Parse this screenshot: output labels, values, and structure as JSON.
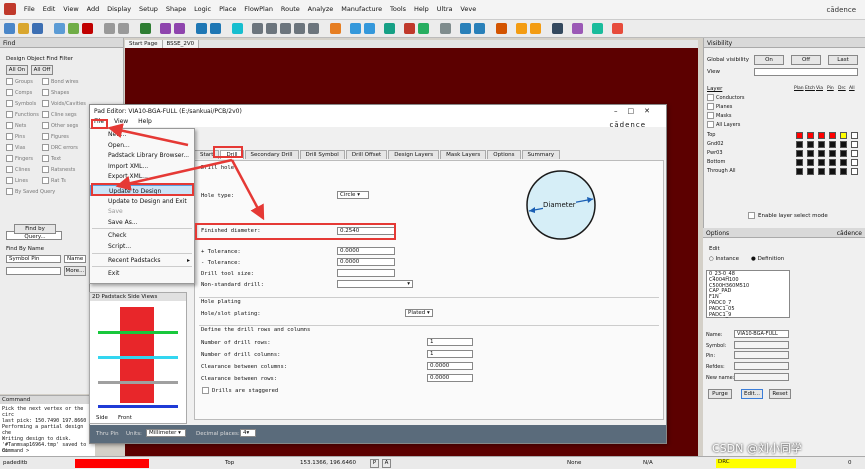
{
  "menubar": {
    "items": [
      "File",
      "Edit",
      "View",
      "Add",
      "Display",
      "Setup",
      "Shape",
      "Logic",
      "Place",
      "FlowPlan",
      "Route",
      "Analyze",
      "Manufacture",
      "Tools",
      "Help",
      "Ultra",
      "Veve"
    ],
    "brand": "cādence"
  },
  "tabs": [
    "Start Page",
    "BSSE_2V0"
  ],
  "find": {
    "title": "Find",
    "filter_title": "Design Object Find Filter",
    "all_on": "All On",
    "all_off": "All Off",
    "left": [
      "Groups",
      "Comps",
      "Symbols",
      "Functions",
      "Nets",
      "Pins",
      "Vias",
      "Fingers",
      "Clines",
      "Lines",
      "By Saved Query"
    ],
    "right": [
      "Bond wires",
      "Shapes",
      "Voids/Cavities",
      "Cline segs",
      "Other segs",
      "Figures",
      "DRC errors",
      "Text",
      "Ratsnests",
      "Rat Ts"
    ],
    "find_by_query": "Find by Query...",
    "find_by_name": "Find By Name",
    "name_type": "Symbol Pin",
    "name_mode": "Name",
    "more": "More..."
  },
  "dialog": {
    "title": "Pad Editor: VIA10-BGA-FULL  (E:/sankuai/PCB/2v0)",
    "menu": [
      "File",
      "View",
      "Help"
    ],
    "brand": "cādence",
    "tabs": [
      "Start",
      "Drill",
      "Secondary Drill",
      "Drill Symbol",
      "Drill Offset",
      "Design Layers",
      "Mask Layers",
      "Options",
      "Summary"
    ],
    "drill_hole": "Drill hole",
    "hole_type_label": "Hole type:",
    "hole_type": "Circle",
    "diameter_label": "Diameter",
    "finished_diameter_label": "Finished diameter:",
    "finished_diameter": "0.2540",
    "plus_tol_label": "+ Tolerance:",
    "plus_tol": "0.0000",
    "minus_tol_label": "- Tolerance:",
    "minus_tol": "0.0000",
    "drill_tool_label": "Drill tool size:",
    "non_std_label": "Non-standard drill:",
    "hole_plating": "Hole plating",
    "plating_label": "Hole/slot plating:",
    "plating": "Plated",
    "rows_cols_title": "Define the drill rows and columns",
    "rows_label": "Number of drill rows:",
    "rows": "1",
    "cols_label": "Number of drill columns:",
    "cols": "1",
    "clear_cols_label": "Clearance between columns:",
    "clear_cols": "0.0000",
    "clear_rows_label": "Clearance between rows:",
    "clear_rows": "0.0000",
    "staggered": "Drills are staggered",
    "thru_pin": "Thru Pin",
    "units_label": "Units:",
    "units": "Millimeter",
    "decimal_label": "Decimal places:",
    "decimal": "4"
  },
  "file_menu": [
    "New...",
    "Open...",
    "Padstack Library Browser...",
    "Import XML...",
    "Export XML...",
    "Update to Design",
    "Update to Design and Exit",
    "Save",
    "Save As...",
    "Check",
    "Script...",
    "Recent Padstacks",
    "Exit"
  ],
  "side_view": {
    "title": "2D Padstack Side Views",
    "tabs": [
      "Side",
      "Front"
    ]
  },
  "visibility": {
    "title": "Visibility",
    "global_label": "Global visibility",
    "on": "On",
    "off": "Off",
    "last": "Last",
    "view_label": "View",
    "layer_label": "Layer",
    "cols": [
      "Plan",
      "Etch",
      "Via",
      "Pin",
      "Drc",
      "All"
    ],
    "groups": [
      "Conductors",
      "Planes",
      "Masks",
      "All Layers"
    ],
    "layers": [
      "Top",
      "Gnd02",
      "Pwr03",
      "Bottom",
      "Through All"
    ],
    "enable_layer_select": "Enable layer select mode",
    "top_colors": [
      "#ff0000",
      "#ff0000",
      "#ff0000",
      "#ff0000",
      "#ffff00"
    ]
  },
  "options": {
    "title": "Options",
    "brand": "cādence",
    "edit": "Edit",
    "instance": "Instance",
    "definition": "Definition",
    "list": [
      "0_23-0_48",
      "C4004H100",
      "C500H360M510",
      "CAP_PAD",
      "F1N",
      "PADC0_7",
      "PADC1_05",
      "PADC1_9"
    ],
    "name_label": "Name:",
    "name": "VIA10-BGA-FULL",
    "symbol_label": "Symbol:",
    "pin_label": "Pin:",
    "refdes_label": "Refdes:",
    "newname_label": "New name:",
    "purge": "Purge",
    "edit_btn": "Edit...",
    "reset": "Reset"
  },
  "command": {
    "title": "Command",
    "lines": [
      "Pick the next vertex or the circ",
      "last pick:  150.7490 197.8660",
      "Performing a partial design che",
      "Writing design to disk.",
      "'#Tanmsap16964.tmp' saved to di"
    ],
    "prompt": "Command >"
  },
  "status": {
    "app": "padeditb",
    "layer": "Top",
    "coords": "153.1366, 196.6460",
    "mode": "P",
    "a": "A",
    "none": "None",
    "na": "N/A",
    "drc": "DRC",
    "num": "0"
  },
  "watermark": "CSDN @刘小同学"
}
